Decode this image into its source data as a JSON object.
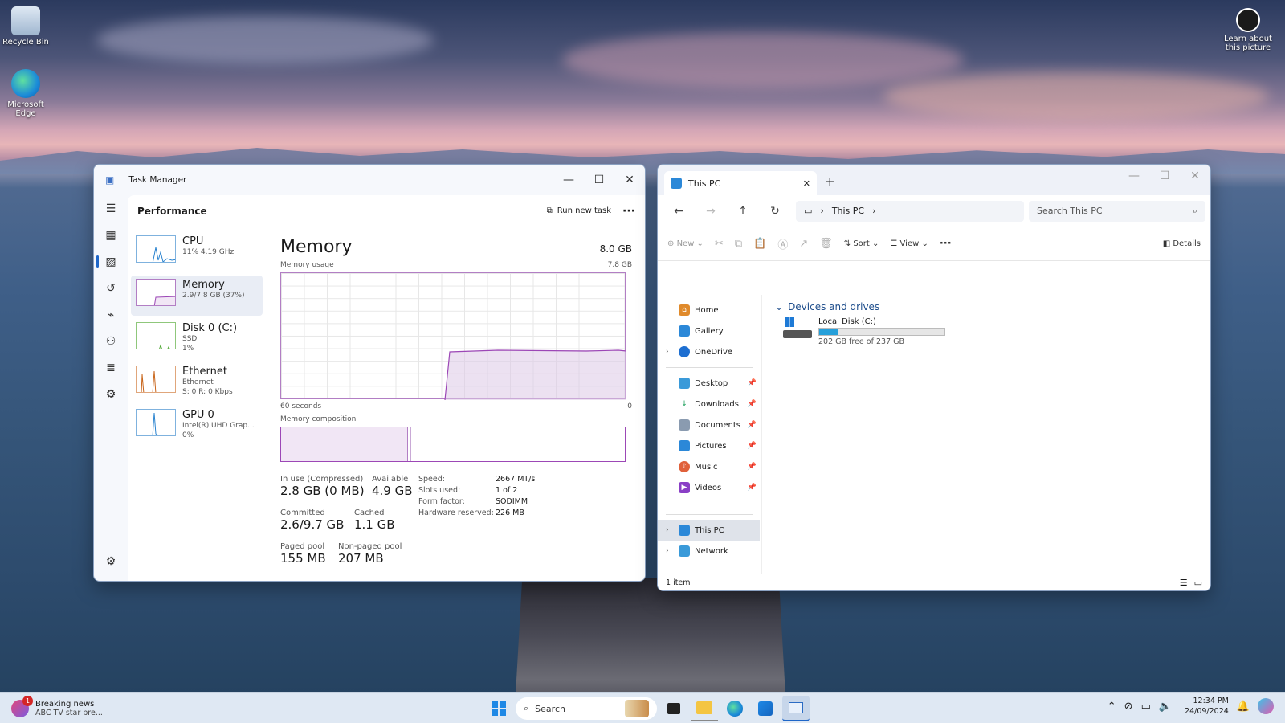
{
  "desktop": {
    "icons": [
      {
        "label": "Recycle Bin"
      },
      {
        "label": "Microsoft Edge"
      }
    ],
    "spotlight_label": "Learn about this picture"
  },
  "task_manager": {
    "title": "Task Manager",
    "section": "Performance",
    "run_new_task": "Run new task",
    "more": "···",
    "items": [
      {
        "name": "CPU",
        "sub1": "11% 4.19 GHz",
        "sub2": "",
        "sub3": ""
      },
      {
        "name": "Memory",
        "sub1": "2.9/7.8 GB (37%)",
        "sub2": "",
        "sub3": ""
      },
      {
        "name": "Disk 0 (C:)",
        "sub1": "SSD",
        "sub2": "1%",
        "sub3": ""
      },
      {
        "name": "Ethernet",
        "sub1": "Ethernet",
        "sub2": "S: 0 R: 0 Kbps",
        "sub3": ""
      },
      {
        "name": "GPU 0",
        "sub1": "Intel(R) UHD Grap...",
        "sub2": "0%",
        "sub3": ""
      }
    ],
    "memory": {
      "heading": "Memory",
      "total": "8.0 GB",
      "usage_label": "Memory usage",
      "usage_max": "7.8 GB",
      "time_left": "60 seconds",
      "time_right": "0",
      "composition_label": "Memory composition",
      "in_use_label": "In use (Compressed)",
      "in_use_value": "2.8 GB (0 MB)",
      "available_label": "Available",
      "available_value": "4.9 GB",
      "committed_label": "Committed",
      "committed_value": "2.6/9.7 GB",
      "cached_label": "Cached",
      "cached_value": "1.1 GB",
      "paged_label": "Paged pool",
      "paged_value": "155 MB",
      "nonpaged_label": "Non-paged pool",
      "nonpaged_value": "207 MB",
      "speed_label": "Speed:",
      "speed_value": "2667 MT/s",
      "slots_label": "Slots used:",
      "slots_value": "1 of 2",
      "form_label": "Form factor:",
      "form_value": "SODIMM",
      "hwres_label": "Hardware reserved:",
      "hwres_value": "226 MB"
    }
  },
  "explorer": {
    "tab_title": "This PC",
    "address_crumb": "This PC",
    "search_placeholder": "Search This PC",
    "cmd": {
      "new": "New",
      "sort": "Sort",
      "view": "View",
      "more": "···",
      "details": "Details"
    },
    "sidebar": [
      {
        "label": "Home",
        "pinned": false
      },
      {
        "label": "Gallery",
        "pinned": false
      },
      {
        "label": "OneDrive",
        "pinned": false
      },
      {
        "label": "Desktop",
        "pinned": true
      },
      {
        "label": "Downloads",
        "pinned": true
      },
      {
        "label": "Documents",
        "pinned": true
      },
      {
        "label": "Pictures",
        "pinned": true
      },
      {
        "label": "Music",
        "pinned": true
      },
      {
        "label": "Videos",
        "pinned": true
      },
      {
        "label": "This PC",
        "pinned": false
      },
      {
        "label": "Network",
        "pinned": false
      }
    ],
    "group_title": "Devices and drives",
    "drive": {
      "name": "Local Disk (C:)",
      "free_text": "202 GB free of 237 GB",
      "used_fraction": 0.15
    },
    "status": "1 item"
  },
  "taskbar": {
    "news_title": "Breaking news",
    "news_sub": "ABC TV star pre...",
    "news_badge": "1",
    "search_label": "Search",
    "time": "12:34 PM",
    "date": "24/09/2024"
  }
}
